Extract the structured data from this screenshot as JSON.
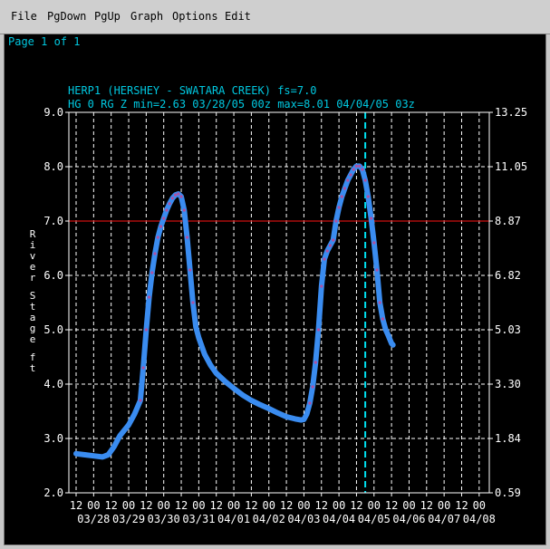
{
  "menu": [
    {
      "label": "File"
    },
    {
      "label": "PgDown"
    },
    {
      "label": "PgUp"
    },
    {
      "label": "Graph"
    },
    {
      "label": "Options"
    },
    {
      "label": "Edit"
    }
  ],
  "page_indicator": "Page 1 of 1",
  "colors": {
    "background": "#000000",
    "text": "#00c8e0",
    "grid": "#ffffff",
    "series": "#3a8cf0",
    "observed_dots": "#b050a0",
    "flood_line": "#cc1010",
    "current_time": "#00e0f0"
  },
  "chart_data": {
    "type": "line",
    "title": "HERP1 (HERSHEY - SWATARA CREEK) fs=7.0",
    "subtitle": "HG 0 RG Z min=2.63 03/28/05 00z max=8.01 04/04/05 03z",
    "ylabel": "River Stage ft",
    "ylim": [
      2.0,
      9.0
    ],
    "y_ticks": [
      "9.0",
      "8.0",
      "7.0",
      "6.0",
      "5.0",
      "4.0",
      "3.0",
      "2.0"
    ],
    "y2_ticks": [
      "13.25",
      "11.05",
      "8.87",
      "6.82",
      "5.03",
      "3.30",
      "1.84",
      "0.59"
    ],
    "x_ticks_hours": [
      "12",
      "00",
      "12",
      "00",
      "12",
      "00",
      "12",
      "00",
      "12",
      "00",
      "12",
      "00",
      "12",
      "00",
      "12",
      "00",
      "12",
      "00",
      "12",
      "00",
      "12",
      "00",
      "12",
      "00"
    ],
    "x_ticks_dates": [
      "03/28",
      "03/29",
      "03/30",
      "03/31",
      "04/01",
      "04/02",
      "04/03",
      "04/04",
      "04/05",
      "04/06",
      "04/07",
      "04/08"
    ],
    "flood_stage": 7.0,
    "current_time_hours": 198,
    "series": [
      {
        "points": [
          [
            0,
            2.72
          ],
          [
            6,
            2.7
          ],
          [
            12,
            2.68
          ],
          [
            18,
            2.66
          ],
          [
            22,
            2.7
          ],
          [
            26,
            2.85
          ],
          [
            30,
            3.05
          ],
          [
            36,
            3.25
          ],
          [
            40,
            3.45
          ],
          [
            44,
            3.7
          ],
          [
            46,
            4.3
          ],
          [
            48,
            5.0
          ],
          [
            50,
            5.6
          ],
          [
            52,
            6.05
          ],
          [
            54,
            6.4
          ],
          [
            56,
            6.7
          ],
          [
            58,
            6.9
          ],
          [
            60,
            7.05
          ],
          [
            62,
            7.2
          ],
          [
            64,
            7.32
          ],
          [
            66,
            7.42
          ],
          [
            68,
            7.48
          ],
          [
            70,
            7.5
          ],
          [
            72,
            7.45
          ],
          [
            74,
            7.2
          ],
          [
            76,
            6.7
          ],
          [
            78,
            6.1
          ],
          [
            80,
            5.5
          ],
          [
            82,
            5.05
          ],
          [
            84,
            4.85
          ],
          [
            88,
            4.55
          ],
          [
            92,
            4.35
          ],
          [
            96,
            4.2
          ],
          [
            102,
            4.05
          ],
          [
            108,
            3.92
          ],
          [
            114,
            3.8
          ],
          [
            120,
            3.7
          ],
          [
            126,
            3.62
          ],
          [
            132,
            3.55
          ],
          [
            138,
            3.47
          ],
          [
            144,
            3.4
          ],
          [
            150,
            3.36
          ],
          [
            154,
            3.34
          ],
          [
            156,
            3.35
          ],
          [
            158,
            3.45
          ],
          [
            160,
            3.65
          ],
          [
            162,
            3.95
          ],
          [
            164,
            4.4
          ],
          [
            166,
            5.0
          ],
          [
            168,
            5.8
          ],
          [
            170,
            6.3
          ],
          [
            172,
            6.45
          ],
          [
            174,
            6.55
          ],
          [
            176,
            6.65
          ],
          [
            178,
            7.0
          ],
          [
            180,
            7.25
          ],
          [
            182,
            7.45
          ],
          [
            184,
            7.6
          ],
          [
            186,
            7.75
          ],
          [
            188,
            7.85
          ],
          [
            190,
            7.95
          ],
          [
            192,
            8.01
          ],
          [
            194,
            8.01
          ],
          [
            196,
            7.95
          ],
          [
            198,
            7.75
          ],
          [
            200,
            7.45
          ],
          [
            202,
            7.05
          ],
          [
            204,
            6.6
          ],
          [
            206,
            6.1
          ],
          [
            208,
            5.5
          ],
          [
            210,
            5.2
          ],
          [
            212,
            5.0
          ],
          [
            214,
            4.88
          ],
          [
            216,
            4.75
          ],
          [
            217,
            4.72
          ]
        ]
      }
    ],
    "observed_ranges": [
      [
        44,
        80
      ],
      [
        160,
        210
      ]
    ]
  }
}
